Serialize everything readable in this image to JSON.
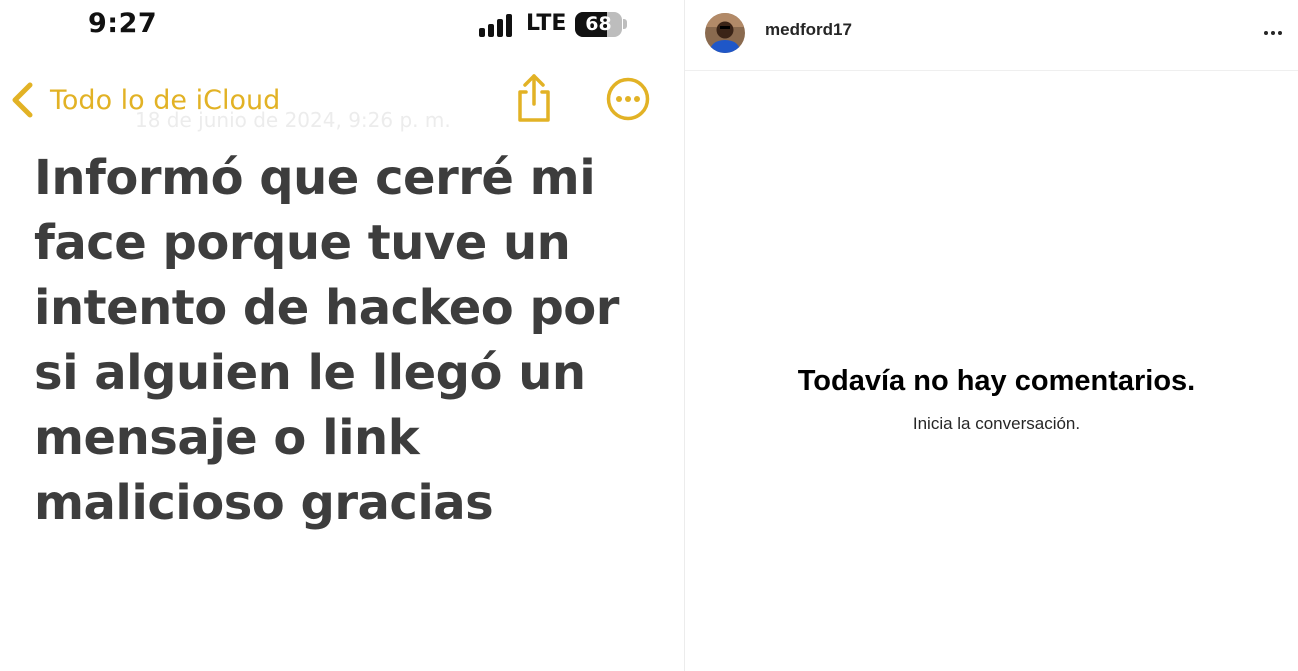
{
  "colors": {
    "notes_accent": "#e2b225",
    "note_text": "#3d3d3d",
    "divider": "#ececec"
  },
  "phone_screenshot": {
    "status_bar": {
      "time": "9:27",
      "network": "LTE",
      "battery_level": "68",
      "battery_fraction": 0.68
    },
    "nav": {
      "back_label": "Todo lo de iCloud",
      "back_icon": "chevron-left-icon",
      "share_icon": "share-icon",
      "more_icon": "more-circle-icon"
    },
    "ghost_date": "18 de junio de 2024, 9:26 p. m.",
    "note_body": "Informó que cerré mi face porque tuve un intento de hackeo por si alguien le llegó un mensaje o link malicioso gracias"
  },
  "instagram": {
    "header": {
      "username": "medford17",
      "options_icon": "more-horizontal-icon"
    },
    "comments": {
      "empty_title": "Todavía no hay comentarios.",
      "empty_subtitle": "Inicia la conversación."
    }
  }
}
